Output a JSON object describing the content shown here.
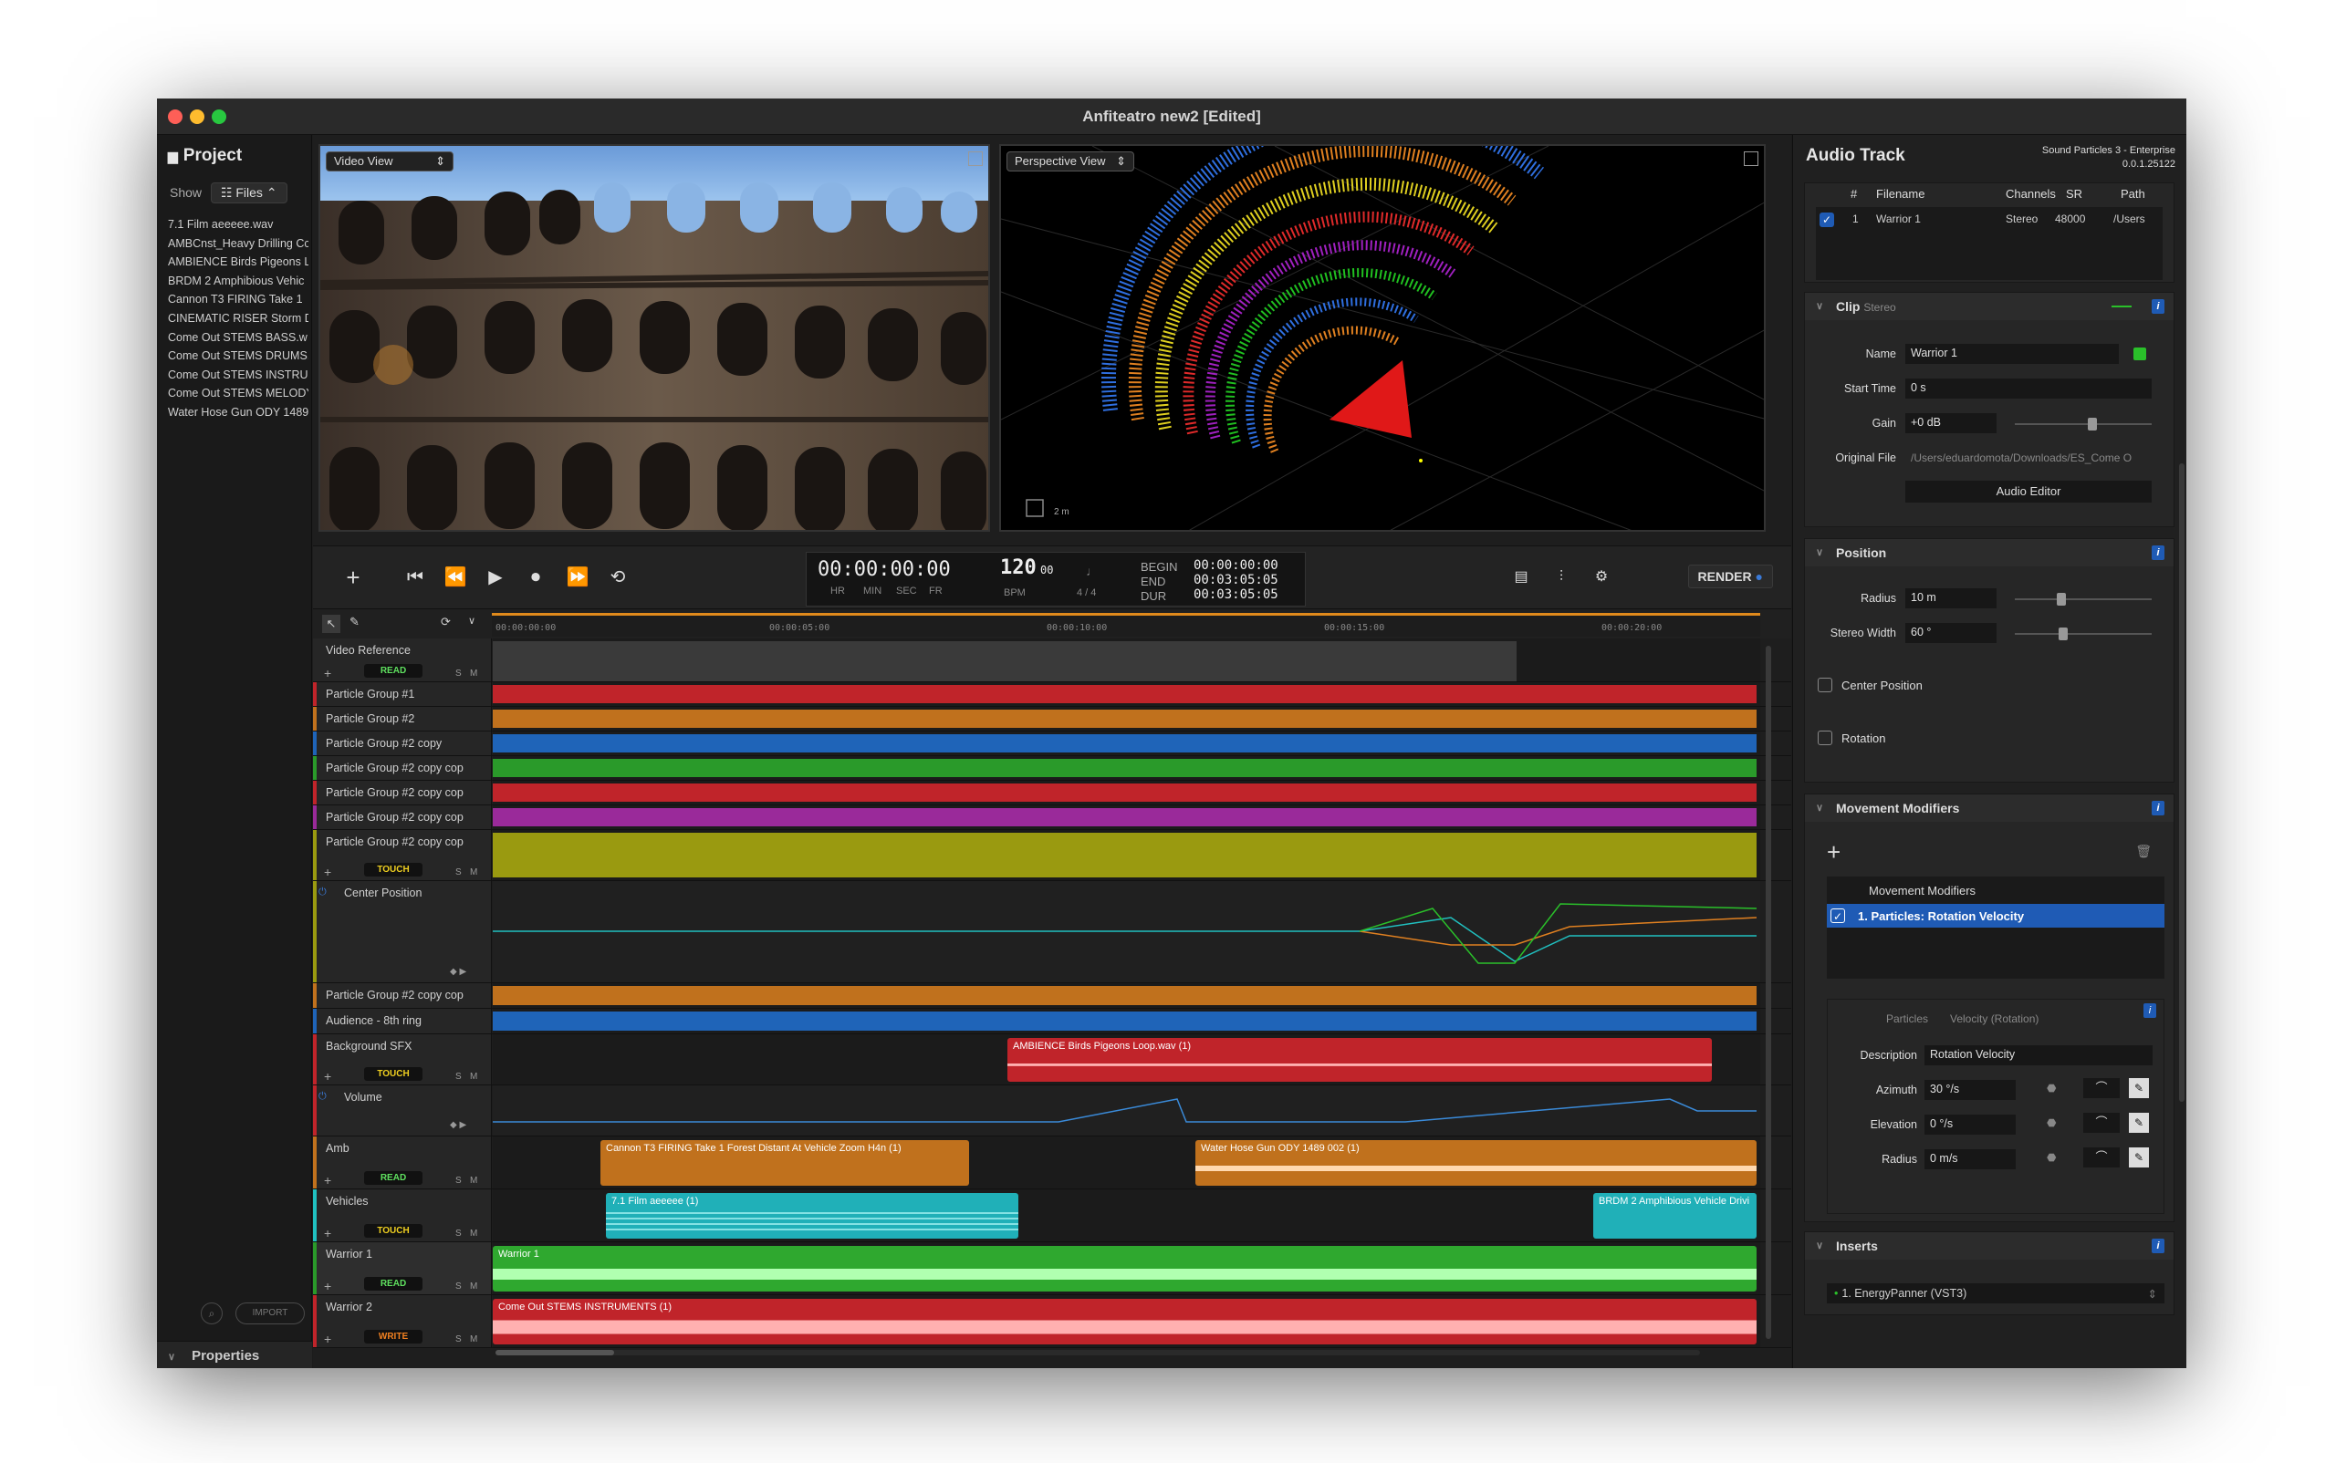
{
  "window": {
    "title": "Anfiteatro new2 [Edited]"
  },
  "project": {
    "title": "Project",
    "show_label": "Show",
    "files_btn": "Files",
    "files": [
      "7.1 Film aeeeee.wav",
      "AMBCnst_Heavy Drilling Cc",
      "AMBIENCE Birds Pigeons L",
      "BRDM 2 Amphibious Vehic",
      "Cannon T3 FIRING Take 1",
      "CINEMATIC RISER Storm D",
      "Come Out STEMS BASS.w",
      "Come Out STEMS DRUMS.",
      "Come Out STEMS INSTRUI",
      "Come Out STEMS MELODY",
      "Water Hose Gun ODY 1489"
    ],
    "import_label": "IMPORT",
    "properties_label": "Properties"
  },
  "views": {
    "video_view": "Video View",
    "perspective_view": "Perspective View",
    "scale_label": "2 m"
  },
  "transport": {
    "time": "00:00:00:00",
    "time_labels": [
      "HR",
      "MIN",
      "SEC",
      "FR"
    ],
    "bpm": "120",
    "bpm_frac": "00",
    "bpm_label": "BPM",
    "signature": "4 / 4",
    "begin_label": "BEGIN",
    "begin": "00:00:00:00",
    "end_label": "END",
    "end": "00:03:05:05",
    "dur_label": "DUR",
    "dur": "00:03:05:05",
    "render": "RENDER"
  },
  "ruler": [
    "00:00:00:00",
    "00:00:05:00",
    "00:00:10:00",
    "00:00:15:00",
    "00:00:20:00"
  ],
  "tracks": {
    "video_ref": "Video Reference",
    "video_mode": "READ",
    "pg1": "Particle Group #1",
    "pg2": "Particle Group #2",
    "pg2c": "Particle Group #2 copy",
    "pg2cc": "Particle Group #2 copy cop",
    "pg2cc2": "Particle Group #2 copy cop",
    "pg2cc3": "Particle Group #2 copy cop",
    "pg2cc4": "Particle Group #2 copy cop",
    "pg2cc4_mode": "TOUCH",
    "center_pos": "Center Position",
    "pg2cc5": "Particle Group #2 copy cop",
    "audience": "Audience - 8th ring",
    "bgsfx": "Background SFX",
    "bgsfx_mode": "TOUCH",
    "bgsfx_clip": "AMBIENCE Birds Pigeons Loop.wav (1)",
    "volume": "Volume",
    "amb": "Amb",
    "amb_mode": "READ",
    "amb_clip1": "Cannon  T3  FIRING  Take 1  Forest  Distant  At Vehicle  Zoom H4n (1)",
    "amb_clip2": "Water Hose Gun ODY 1489 002 (1)",
    "vehicles": "Vehicles",
    "vehicles_mode": "TOUCH",
    "veh_clip1": "7.1  Film aeeeee (1)",
    "veh_clip2": "BRDM 2 Amphibious Vehicle  Drivi",
    "warrior1": "Warrior 1",
    "warrior1_mode": "READ",
    "warrior1_clip": "Warrior 1",
    "warrior2": "Warrior 2",
    "warrior2_mode": "WRITE",
    "warrior2_clip": "Come Out STEMS INSTRUMENTS (1)",
    "s": "S",
    "m": "M"
  },
  "right": {
    "title": "Audio Track",
    "product": "Sound Particles 3 - Enterprise",
    "version": "0.0.1.25122",
    "table_cols": [
      "#",
      "Filename",
      "Channels",
      "SR",
      "Path"
    ],
    "table_row": [
      "1",
      "Warrior 1",
      "Stereo",
      "48000",
      "/Users"
    ],
    "clip_title": "Clip",
    "clip_sub": "Stereo",
    "name_label": "Name",
    "name_val": "Warrior 1",
    "start_label": "Start Time",
    "start_val": "0 s",
    "gain_label": "Gain",
    "gain_val": "+0 dB",
    "orig_label": "Original File",
    "orig_val": "/Users/eduardomota/Downloads/ES_Come O",
    "audio_editor": "Audio Editor",
    "position_title": "Position",
    "radius_label": "Radius",
    "radius_val": "10 m",
    "sw_label": "Stereo Width",
    "sw_val": "60 °",
    "center_pos": "Center Position",
    "rotation": "Rotation",
    "mm_title": "Movement Modifiers",
    "mm_list_hdr": "Movement Modifiers",
    "mm_item": "1. Particles: Rotation Velocity",
    "mm_particles": "Particles",
    "mm_vel": "Velocity (Rotation)",
    "desc_label": "Description",
    "desc_val": "Rotation Velocity",
    "az_label": "Azimuth",
    "az_val": "30 °/s",
    "el_label": "Elevation",
    "el_val": "0 °/s",
    "rad_label": "Radius",
    "rad_val": "0 m/s",
    "inserts_title": "Inserts",
    "insert_item": "1. EnergyPanner (VST3)"
  },
  "colors": {
    "red": "#c0242a",
    "orange": "#c0711d",
    "blue": "#1f64b8",
    "green": "#2a9a2a",
    "purple": "#9a2a9a",
    "olive": "#9a9a10",
    "accent": "#e08a1c"
  }
}
